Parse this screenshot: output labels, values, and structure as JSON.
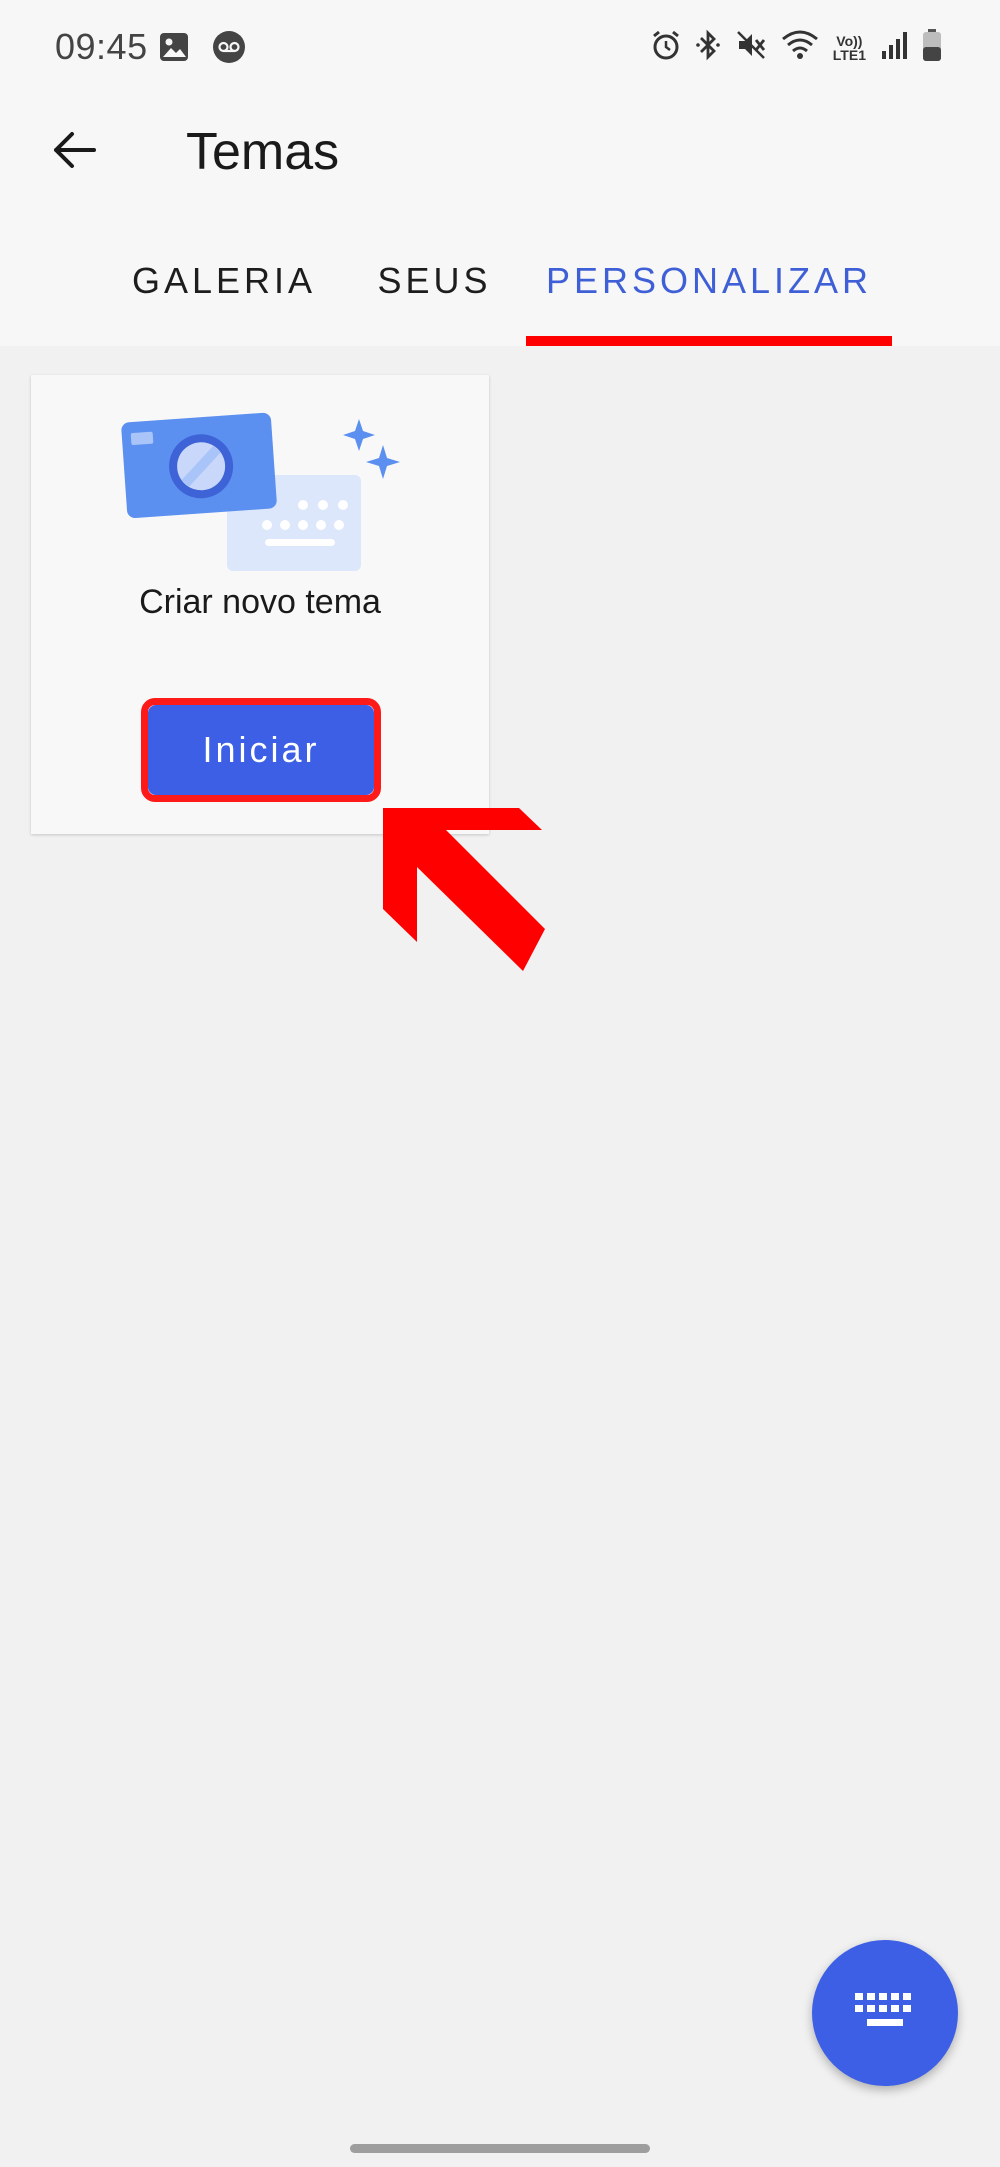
{
  "status_bar": {
    "time": "09:45",
    "left_icons": [
      "image-icon",
      "voicemail-icon"
    ],
    "right_icons": [
      "alarm-icon",
      "bluetooth-icon",
      "mute-icon",
      "wifi-icon",
      "volte-icon",
      "signal-icon",
      "battery-icon"
    ],
    "volte_label_top": "Vo))",
    "volte_label_bottom": "LTE1"
  },
  "header": {
    "back_icon": "arrow-left-icon",
    "title": "Temas"
  },
  "tabs": [
    {
      "label": "GALERIA",
      "active": false
    },
    {
      "label": "SEUS",
      "active": false
    },
    {
      "label": "PERSONALIZAR",
      "active": true
    }
  ],
  "card": {
    "caption": "Criar novo tema",
    "button_label": "Iniciar"
  },
  "fab": {
    "icon": "keyboard-icon"
  },
  "colors": {
    "accent": "#3c5fe6",
    "active_tab_text": "#3f5fd6",
    "highlight": "#ff0000",
    "background": "#f1f1f1"
  }
}
